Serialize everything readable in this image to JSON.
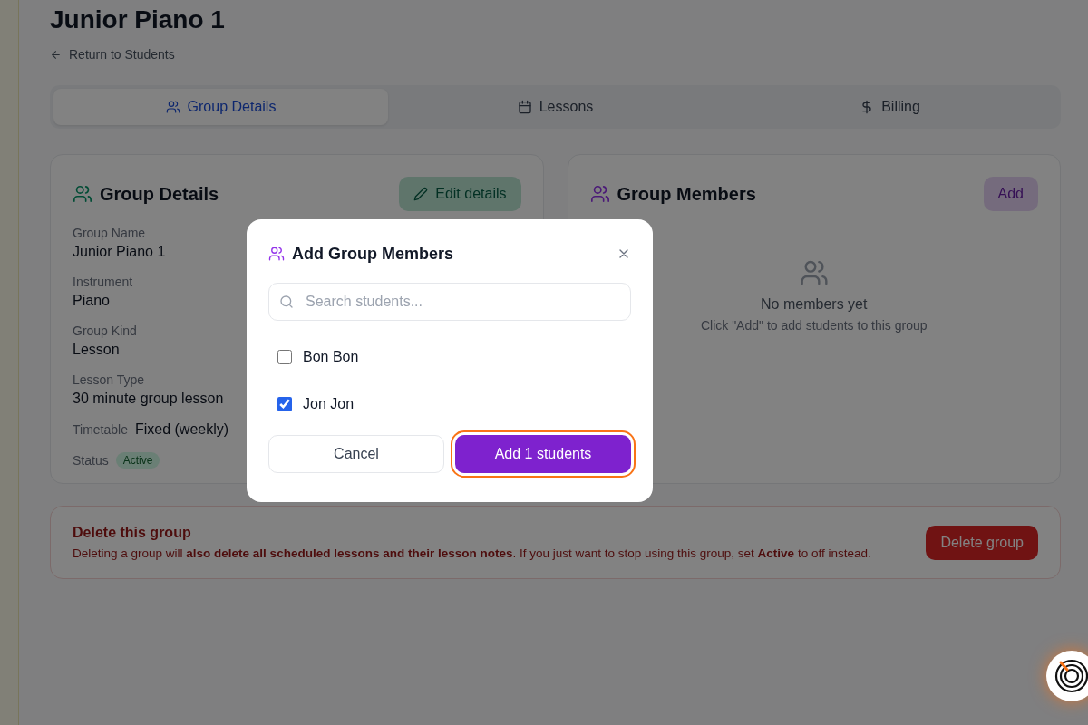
{
  "page": {
    "title": "Junior Piano 1",
    "back_link": "Return to Students"
  },
  "tabs": [
    {
      "label": "Group Details",
      "selected": true
    },
    {
      "label": "Lessons",
      "selected": false
    },
    {
      "label": "Billing",
      "selected": false
    }
  ],
  "details_card": {
    "title": "Group Details",
    "edit_button": "Edit details",
    "fields": [
      {
        "kind": "stacked",
        "label": "Group Name",
        "value": "Junior Piano 1"
      },
      {
        "kind": "stacked",
        "label": "Instrument",
        "value": "Piano"
      },
      {
        "kind": "stacked",
        "label": "Group Kind",
        "value": "Lesson"
      },
      {
        "kind": "stacked",
        "label": "Lesson Type",
        "value": "30 minute group lesson"
      },
      {
        "kind": "inline",
        "label": "Timetable",
        "value": "Fixed (weekly)"
      },
      {
        "kind": "badge",
        "label": "Status",
        "value": "Active"
      }
    ]
  },
  "members_card": {
    "title": "Group Members",
    "add_button": "Add",
    "empty_title": "No members yet",
    "empty_hint": "Click \"Add\" to add students to this group"
  },
  "danger_zone": {
    "title": "Delete this group",
    "text": "Deleting a group will **also delete all scheduled lessons and their lesson notes**. If you just want to stop using this group, set **Active** to off instead.",
    "button": "Delete group"
  },
  "dialog": {
    "title": "Add Group Members",
    "search": {
      "placeholder": "Search students..."
    },
    "students": [
      {
        "name": "Bon Bon",
        "checked": false
      },
      {
        "name": "Jon Jon",
        "checked": true
      }
    ],
    "cancel_button": "Cancel",
    "confirm_button": "Add 1 students",
    "confirm_focused": true
  }
}
